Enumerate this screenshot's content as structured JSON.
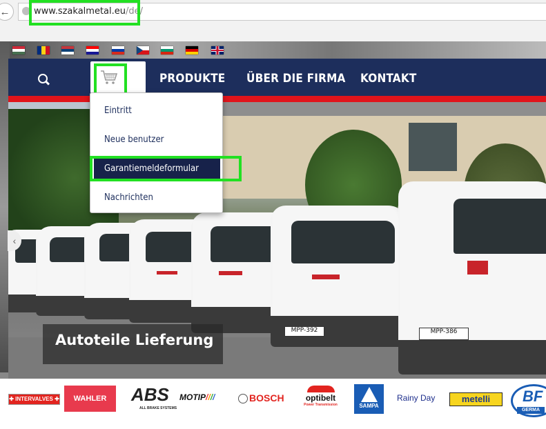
{
  "browser": {
    "url_domain": "www.szakalmetal.eu",
    "url_path": "/de/"
  },
  "languages": [
    {
      "name": "hu",
      "colors": [
        "#ce2939",
        "#ffffff",
        "#477050"
      ],
      "orient": "h"
    },
    {
      "name": "ro",
      "colors": [
        "#002b7f",
        "#fcd116",
        "#ce1126"
      ],
      "orient": "v"
    },
    {
      "name": "rs",
      "colors": [
        "#c6363c",
        "#0c4076",
        "#ffffff"
      ],
      "orient": "h"
    },
    {
      "name": "hr",
      "colors": [
        "#ff0000",
        "#ffffff",
        "#171796"
      ],
      "orient": "h"
    },
    {
      "name": "ru",
      "colors": [
        "#ffffff",
        "#0039a6",
        "#d52b1e"
      ],
      "orient": "h"
    },
    {
      "name": "cz",
      "colors": [
        "#ffffff",
        "#d7141a",
        "#11457e"
      ],
      "orient": "h"
    },
    {
      "name": "bg",
      "colors": [
        "#ffffff",
        "#00966e",
        "#d62612"
      ],
      "orient": "h"
    },
    {
      "name": "de",
      "colors": [
        "#000000",
        "#dd0000",
        "#ffce00"
      ],
      "orient": "h"
    },
    {
      "name": "gb",
      "colors": [
        "#012169",
        "#ffffff",
        "#c8102e"
      ],
      "orient": "h"
    }
  ],
  "nav": {
    "items": [
      "PRODUKTE",
      "ÜBER DIE FIRMA",
      "KONTAKT"
    ]
  },
  "cart_menu": {
    "items": [
      "Eintritt",
      "Neue benutzer",
      "Garantiemeldeformular",
      "Nachrichten"
    ],
    "active": "Garantiemeldeformular"
  },
  "hero": {
    "caption": "Autoteile Lieferung",
    "plates": [
      "MPP-386",
      "MPP-392"
    ]
  },
  "brands": {
    "intervalves": "INTERVALVES",
    "wahler": "WAHLER",
    "abs": "ABS",
    "abs_sub": "ALL BRAKE SYSTEMS",
    "motip": "MOTIP",
    "bosch": "BOSCH",
    "optibelt": "optibelt",
    "optibelt_sub": "Power Transmission",
    "sampa": "SAMPA",
    "rainyday": "Rainy Day",
    "metelli": "metelli",
    "bf": "BF",
    "bf_sub": "GERMA"
  },
  "colors": {
    "navbar": "#1d2e5c",
    "accent_red": "#e0141b",
    "highlight": "#22e022"
  }
}
